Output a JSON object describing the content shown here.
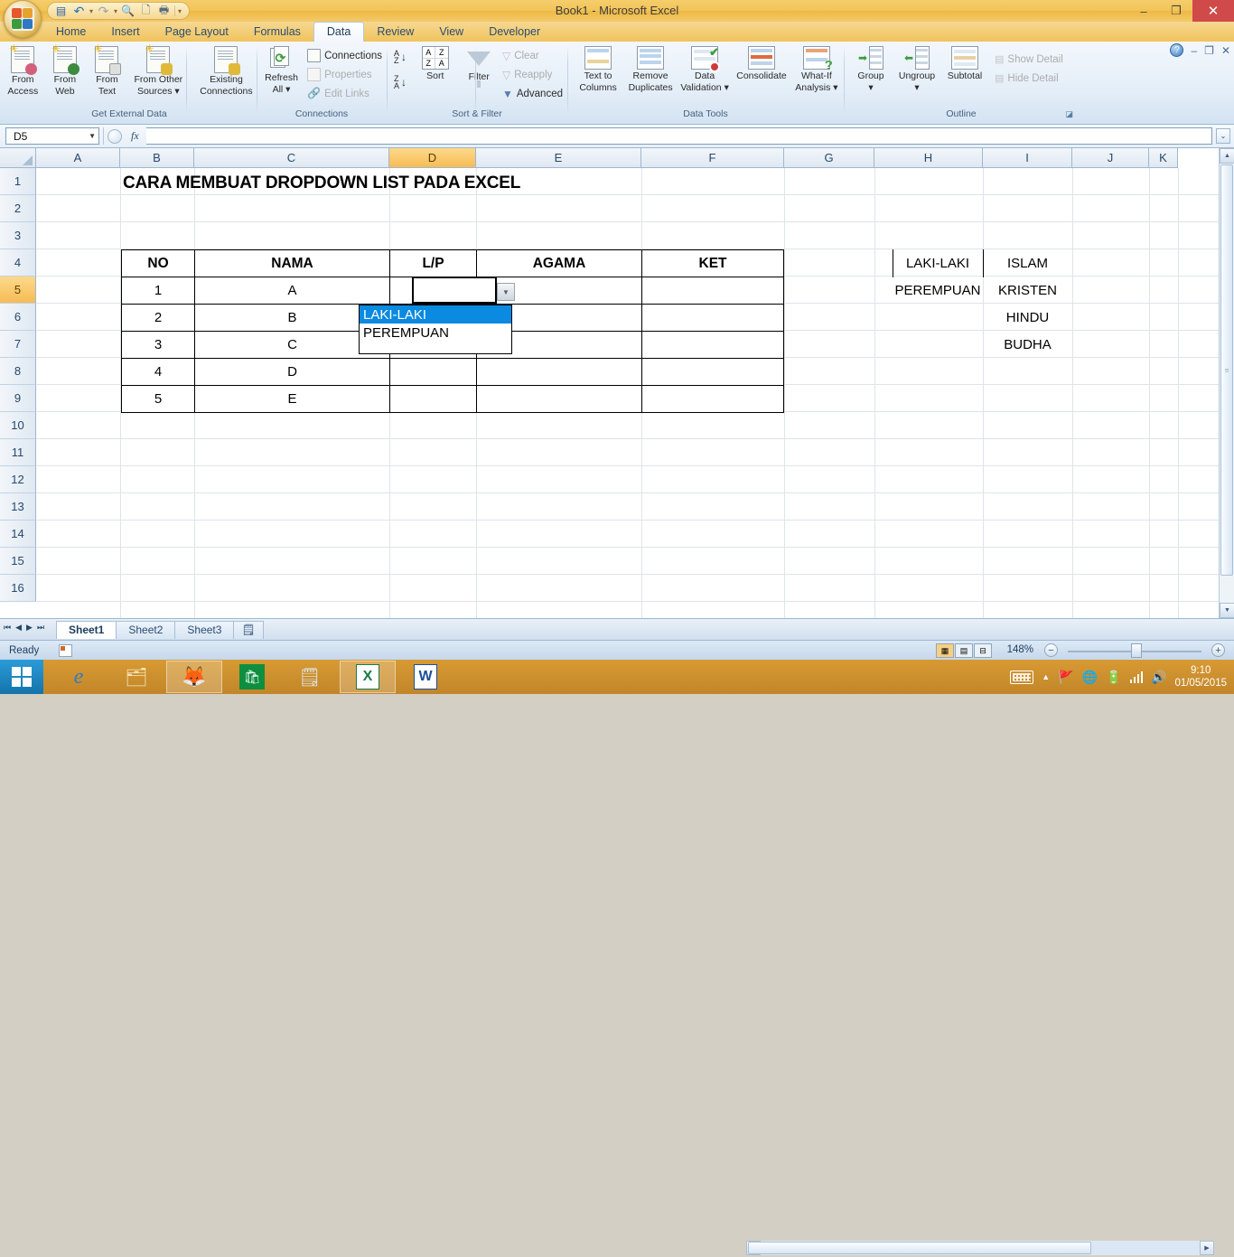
{
  "window": {
    "title": "Book1 - Microsoft Excel",
    "controls": {
      "minimize": "–",
      "restore": "❐",
      "close": "✕"
    }
  },
  "quick_access": {
    "items": [
      {
        "name": "save-icon",
        "glyph": "💾"
      },
      {
        "name": "undo-icon",
        "glyph": "↰"
      },
      {
        "name": "redo-icon",
        "glyph": "↱"
      },
      {
        "name": "print-preview-icon",
        "glyph": "🔍"
      },
      {
        "name": "new-icon",
        "glyph": "🗋"
      },
      {
        "name": "print-icon",
        "glyph": "🖶"
      }
    ],
    "customize_glyph": "▾"
  },
  "ribbon": {
    "tabs": [
      {
        "label": "Home",
        "active": false
      },
      {
        "label": "Insert",
        "active": false
      },
      {
        "label": "Page Layout",
        "active": false
      },
      {
        "label": "Formulas",
        "active": false
      },
      {
        "label": "Data",
        "active": true
      },
      {
        "label": "Review",
        "active": false
      },
      {
        "label": "View",
        "active": false
      },
      {
        "label": "Developer",
        "active": false
      }
    ],
    "window_buttons": {
      "help": "?",
      "minimize": "–",
      "restore": "❐",
      "close": "✕"
    },
    "groups": [
      {
        "name": "get-external-data",
        "label": "Get External Data",
        "buttons": [
          {
            "line1": "From",
            "line2": "Access",
            "disabled": false
          },
          {
            "line1": "From",
            "line2": "Web",
            "disabled": false
          },
          {
            "line1": "From",
            "line2": "Text",
            "disabled": false
          },
          {
            "line1": "From Other",
            "line2": "Sources ▾",
            "disabled": false
          },
          {
            "line1": "Existing",
            "line2": "Connections",
            "disabled": false
          }
        ]
      },
      {
        "name": "connections",
        "label": "Connections",
        "big": {
          "line1": "Refresh",
          "line2": "All ▾"
        },
        "small": [
          {
            "label": "Connections",
            "disabled": false
          },
          {
            "label": "Properties",
            "disabled": true
          },
          {
            "label": "Edit Links",
            "disabled": true
          }
        ]
      },
      {
        "name": "sort-filter",
        "label": "Sort & Filter",
        "sort_label": "Sort",
        "filter_label": "Filter",
        "az_label": "A Z ↓",
        "za_label": "Z A ↓",
        "small": [
          {
            "label": "Clear",
            "disabled": true
          },
          {
            "label": "Reapply",
            "disabled": true
          },
          {
            "label": "Advanced",
            "disabled": false
          }
        ]
      },
      {
        "name": "data-tools",
        "label": "Data Tools",
        "buttons": [
          {
            "line1": "Text to",
            "line2": "Columns"
          },
          {
            "line1": "Remove",
            "line2": "Duplicates"
          },
          {
            "line1": "Data",
            "line2": "Validation ▾"
          },
          {
            "line1": "Consolidate",
            "line2": ""
          },
          {
            "line1": "What-If",
            "line2": "Analysis ▾"
          }
        ]
      },
      {
        "name": "outline",
        "label": "Outline",
        "buttons": [
          {
            "line1": "Group",
            "line2": "▾"
          },
          {
            "line1": "Ungroup",
            "line2": "▾"
          },
          {
            "line1": "Subtotal",
            "line2": ""
          }
        ],
        "small": [
          {
            "label": "Show Detail",
            "disabled": true
          },
          {
            "label": "Hide Detail",
            "disabled": true
          }
        ],
        "dialog_launcher": "◪"
      }
    ]
  },
  "formula_bar": {
    "name_box_value": "D5",
    "name_box_arrow": "▼",
    "fx_label": "fx",
    "formula_value": "",
    "expand_glyph": "⌄"
  },
  "grid": {
    "column_headers": [
      "A",
      "B",
      "C",
      "D",
      "E",
      "F",
      "G",
      "H",
      "I",
      "J",
      "K"
    ],
    "selected_column": "D",
    "row_headers": [
      "1",
      "2",
      "3",
      "4",
      "5",
      "6",
      "7",
      "8",
      "9",
      "10",
      "11",
      "12",
      "13",
      "14",
      "15",
      "16"
    ],
    "selected_row": "5",
    "title_cell": "CARA MEMBUAT DROPDOWN LIST PADA EXCEL",
    "table": {
      "headers": [
        "NO",
        "NAMA",
        "L/P",
        "AGAMA",
        "KET"
      ],
      "rows": [
        {
          "no": "1",
          "nama": "A",
          "lp": "",
          "agama": "",
          "ket": ""
        },
        {
          "no": "2",
          "nama": "B",
          "lp": "",
          "agama": "",
          "ket": ""
        },
        {
          "no": "3",
          "nama": "C",
          "lp": "",
          "agama": "",
          "ket": ""
        },
        {
          "no": "4",
          "nama": "D",
          "lp": "",
          "agama": "",
          "ket": ""
        },
        {
          "no": "5",
          "nama": "E",
          "lp": "",
          "agama": "",
          "ket": ""
        }
      ]
    },
    "lookup_lists": {
      "gender": [
        "LAKI-LAKI",
        "PEREMPUAN"
      ],
      "religion": [
        "ISLAM",
        "KRISTEN",
        "HINDU",
        "BUDHA"
      ]
    },
    "dropdown": {
      "open": true,
      "arrow_glyph": "▼",
      "options": [
        "LAKI-LAKI",
        "PEREMPUAN"
      ],
      "highlighted": "LAKI-LAKI"
    }
  },
  "sheet_tabs": {
    "nav": [
      "⏮",
      "◀",
      "▶",
      "⏭"
    ],
    "tabs": [
      {
        "label": "Sheet1",
        "active": true
      },
      {
        "label": "Sheet2",
        "active": false
      },
      {
        "label": "Sheet3",
        "active": false
      }
    ],
    "new_sheet_glyph": "🗒"
  },
  "status_bar": {
    "status_text": "Ready",
    "view_buttons": [
      "normal-view",
      "page-layout-view",
      "page-break-view"
    ],
    "zoom_level": "148%",
    "zoom_out": "−",
    "zoom_in": "+"
  },
  "taskbar": {
    "apps": [
      {
        "name": "internet-explorer",
        "glyph": "e"
      },
      {
        "name": "file-explorer",
        "glyph": "🗂"
      },
      {
        "name": "firefox",
        "glyph": "🦊"
      },
      {
        "name": "windows-store",
        "glyph": "🛍"
      },
      {
        "name": "sticky-notes",
        "glyph": "🗒"
      },
      {
        "name": "excel",
        "glyph": "X"
      },
      {
        "name": "word",
        "glyph": "W"
      }
    ],
    "tray": {
      "time": "9:10",
      "date": "01/05/2015"
    }
  },
  "colors": {
    "title_bar": "#f2c45a",
    "ribbon_bg": "#e4eef8",
    "accent_selection": "#0a8ae0",
    "header_selected": "#f6bc55",
    "taskbar": "#c2862a"
  }
}
